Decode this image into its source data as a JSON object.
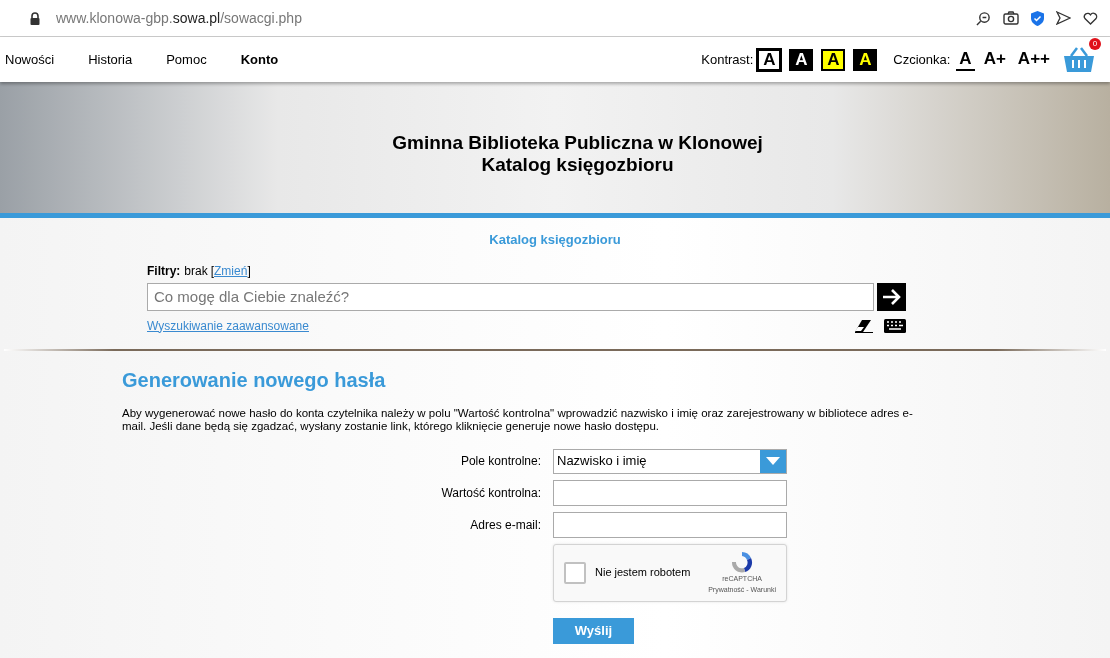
{
  "address_bar": {
    "host_prefix": "www.klonowa-gbp.",
    "host_domain": "sowa.pl",
    "path": "/sowacgi.php"
  },
  "nav": {
    "items": [
      {
        "label": "Nowości",
        "selected": false
      },
      {
        "label": "Historia",
        "selected": false
      },
      {
        "label": "Pomoc",
        "selected": false
      },
      {
        "label": "Konto",
        "selected": true
      }
    ],
    "contrast_label": "Kontrast:",
    "contrast_options": [
      {
        "label": "A",
        "kind": "normal",
        "selected": true
      },
      {
        "label": "A",
        "kind": "inverted",
        "selected": false
      },
      {
        "label": "A",
        "kind": "yellow",
        "selected": false
      },
      {
        "label": "A",
        "kind": "darkyellow",
        "selected": false
      }
    ],
    "font_label": "Czcionka:",
    "font_options": [
      {
        "label": "A",
        "selected": true
      },
      {
        "label": "A+",
        "selected": false
      },
      {
        "label": "A++",
        "selected": false
      }
    ],
    "cart_count": "0"
  },
  "banner": {
    "title": "Gminna Biblioteka Publiczna w Klonowej",
    "subtitle": "Katalog księgozbioru"
  },
  "search": {
    "heading": "Katalog księgozbioru",
    "filters_label": "Filtry:",
    "filters_value": "brak",
    "bracket_open": "[",
    "filters_link": "Zmień",
    "bracket_close": "]",
    "placeholder": "Co mogę dla Ciebie znaleźć?",
    "advanced_link": "Wyszukiwanie zaawansowane"
  },
  "form": {
    "title": "Generowanie nowego hasła",
    "description": "Aby wygenerować nowe hasło do konta czytelnika należy w polu \"Wartość kontrolna\" wprowadzić nazwisko i imię oraz zarejestrowany w bibliotece adres e-mail. Jeśli dane będą się zgadzać, wysłany zostanie link, którego kliknięcie generuje nowe hasło dostępu.",
    "fields": [
      {
        "label": "Pole kontrolne:",
        "kind": "select",
        "value": "Nazwisko i imię"
      },
      {
        "label": "Wartość kontrolna:",
        "kind": "text"
      },
      {
        "label": "Adres e-mail:",
        "kind": "text"
      }
    ],
    "captcha": {
      "label": "Nie jestem robotem",
      "checked": false,
      "brand": "reCAPTCHA",
      "links": "Prywatność - Warunki"
    },
    "submit": "Wyślij"
  }
}
